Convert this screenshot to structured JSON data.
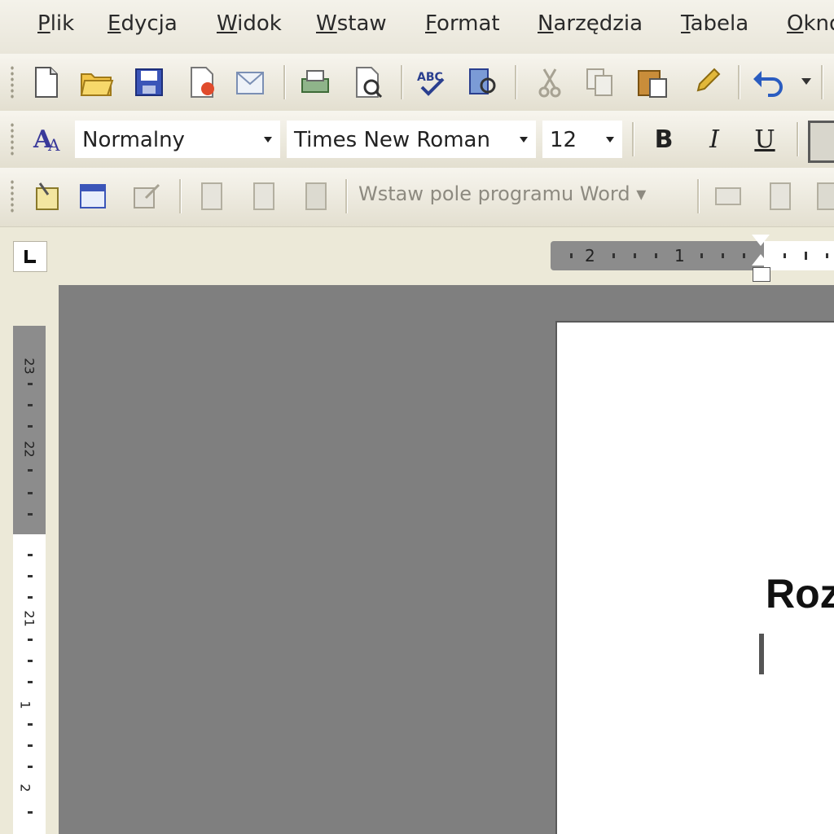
{
  "menu": {
    "items": [
      {
        "key": "P",
        "rest": "lik",
        "label": "Plik"
      },
      {
        "key": "E",
        "rest": "dycja",
        "label": "Edycja"
      },
      {
        "key": "W",
        "rest": "idok",
        "label": "Widok"
      },
      {
        "key": "W",
        "rest": "staw",
        "label": "Wstaw"
      },
      {
        "key": "F",
        "rest": "ormat",
        "label": "Format"
      },
      {
        "key": "N",
        "rest": "arzędzia",
        "label": "Narzędzia"
      },
      {
        "key": "T",
        "rest": "abela",
        "label": "Tabela"
      },
      {
        "key": "O",
        "rest": "kno",
        "label": "Okno"
      }
    ]
  },
  "formatting": {
    "style": "Normalny",
    "font": "Times New Roman",
    "size": "12",
    "bold": "B",
    "italic": "I",
    "underline": "U"
  },
  "fields_toolbar": {
    "insert_field": "Wstaw pole programu Word ▾"
  },
  "ruler": {
    "h_numbers": [
      "2",
      "1"
    ],
    "v_numbers": [
      "23",
      "22",
      "21",
      "1",
      "2"
    ]
  },
  "document": {
    "heading": "Roz"
  },
  "colors": {
    "chrome": "#ece9d8",
    "workspace": "#7f7f7f",
    "page": "#ffffff"
  }
}
